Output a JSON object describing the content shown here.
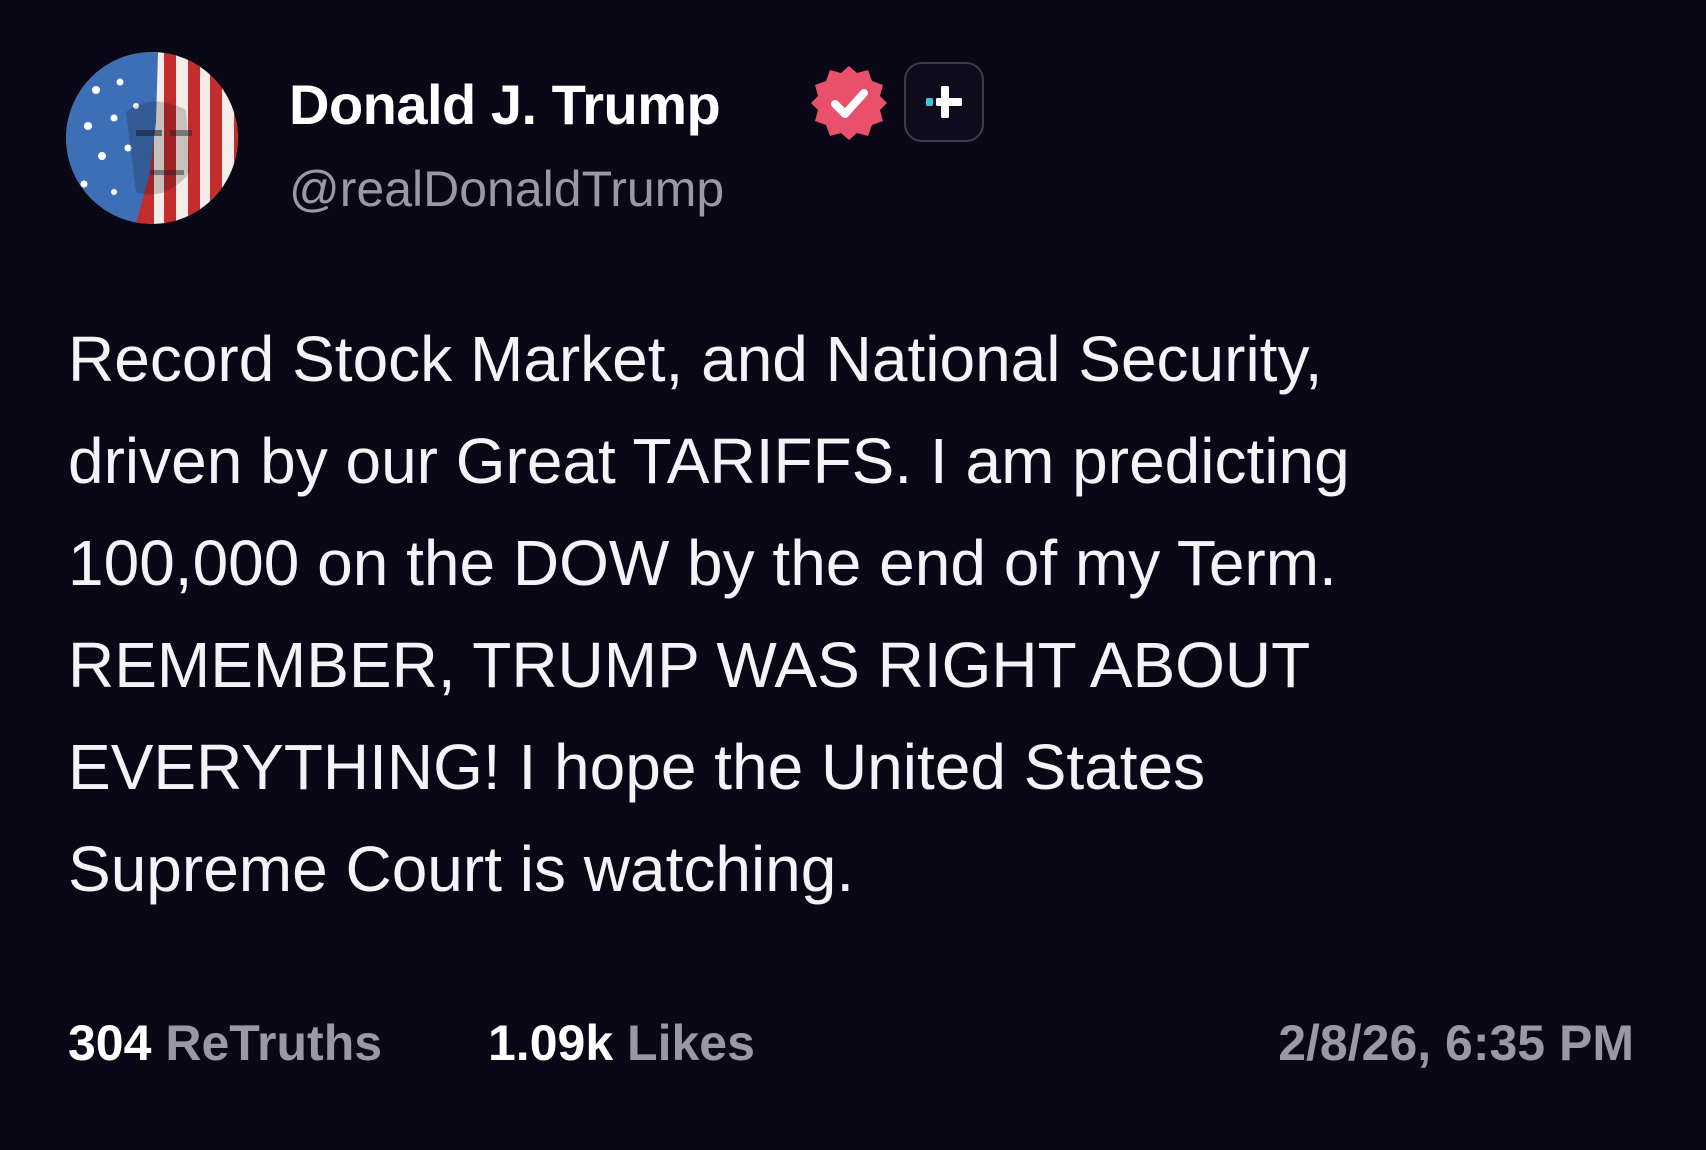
{
  "post": {
    "author": {
      "display_name": "Donald J. Trump",
      "handle": "@realDonaldTrump",
      "verified_icon": "verified-check-badge-icon",
      "plus_icon": "plus-badge-icon"
    },
    "body_lines": [
      "Record Stock Market, and National Security,",
      "driven by our Great TARIFFS. I am predicting",
      "100,000 on the DOW by the end of my Term.",
      "REMEMBER, TRUMP WAS RIGHT ABOUT",
      "EVERYTHING! I hope the United States",
      "Supreme Court is watching."
    ],
    "stats": {
      "retruths_count": "304",
      "retruths_label": "ReTruths",
      "likes_count": "1.09k",
      "likes_label": "Likes"
    },
    "timestamp": "2/8/26, 6:35 PM"
  },
  "colors": {
    "background": "#0a0817",
    "text_primary": "#ffffff",
    "text_secondary": "#9a98a8",
    "verified_badge": "#e8506b"
  }
}
